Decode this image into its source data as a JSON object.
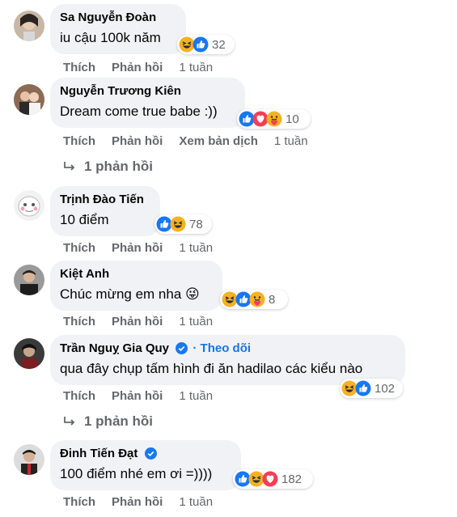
{
  "comments": [
    {
      "name": "Sa Nguyễn Đoàn",
      "text": "iu cậu 100k năm",
      "reaction_count": "32",
      "reactions": [
        "haha",
        "like"
      ],
      "like_label": "Thích",
      "reply_label": "Phản hồi",
      "time": "1 tuần"
    },
    {
      "name": "Nguyễn Trương Kiên",
      "text": "Dream come true babe :))",
      "reaction_count": "10",
      "reactions": [
        "like",
        "love",
        "care"
      ],
      "like_label": "Thích",
      "reply_label": "Phản hồi",
      "translate_label": "Xem bản dịch",
      "time": "1 tuần",
      "replies_label": "1 phản hồi"
    },
    {
      "name": "Trịnh Đào Tiến",
      "text": "10 điểm",
      "reaction_count": "78",
      "reactions": [
        "like",
        "haha"
      ],
      "like_label": "Thích",
      "reply_label": "Phản hồi",
      "time": "1 tuần"
    },
    {
      "name": "Kiệt Anh",
      "text": "Chúc mừng em nha 😜",
      "reaction_count": "8",
      "reactions": [
        "haha",
        "like",
        "care"
      ],
      "like_label": "Thích",
      "reply_label": "Phản hồi",
      "time": "1 tuần"
    },
    {
      "name": "Trần Nguỵ Gia Quy",
      "verified": true,
      "follow_label": "· Theo dõi",
      "text": "qua đây chụp tấm hình đi ăn hadilao các kiểu nào",
      "reaction_count": "102",
      "reactions": [
        "haha",
        "like"
      ],
      "like_label": "Thích",
      "reply_label": "Phản hồi",
      "time": "1 tuần",
      "replies_label": "1 phản hồi"
    },
    {
      "name": "Đinh Tiến Đạt",
      "verified": true,
      "text": "100 điểm nhé em ơi =))))",
      "reaction_count": "182",
      "reactions": [
        "like",
        "haha",
        "love"
      ],
      "like_label": "Thích",
      "reply_label": "Phản hồi",
      "time": "1 tuần"
    }
  ],
  "colors": {
    "bubble": "#f0f2f5",
    "meta": "#65676b",
    "link": "#1b74e4",
    "like": "#1877f2",
    "love": "#f33e58",
    "haha": "#f7b125"
  }
}
